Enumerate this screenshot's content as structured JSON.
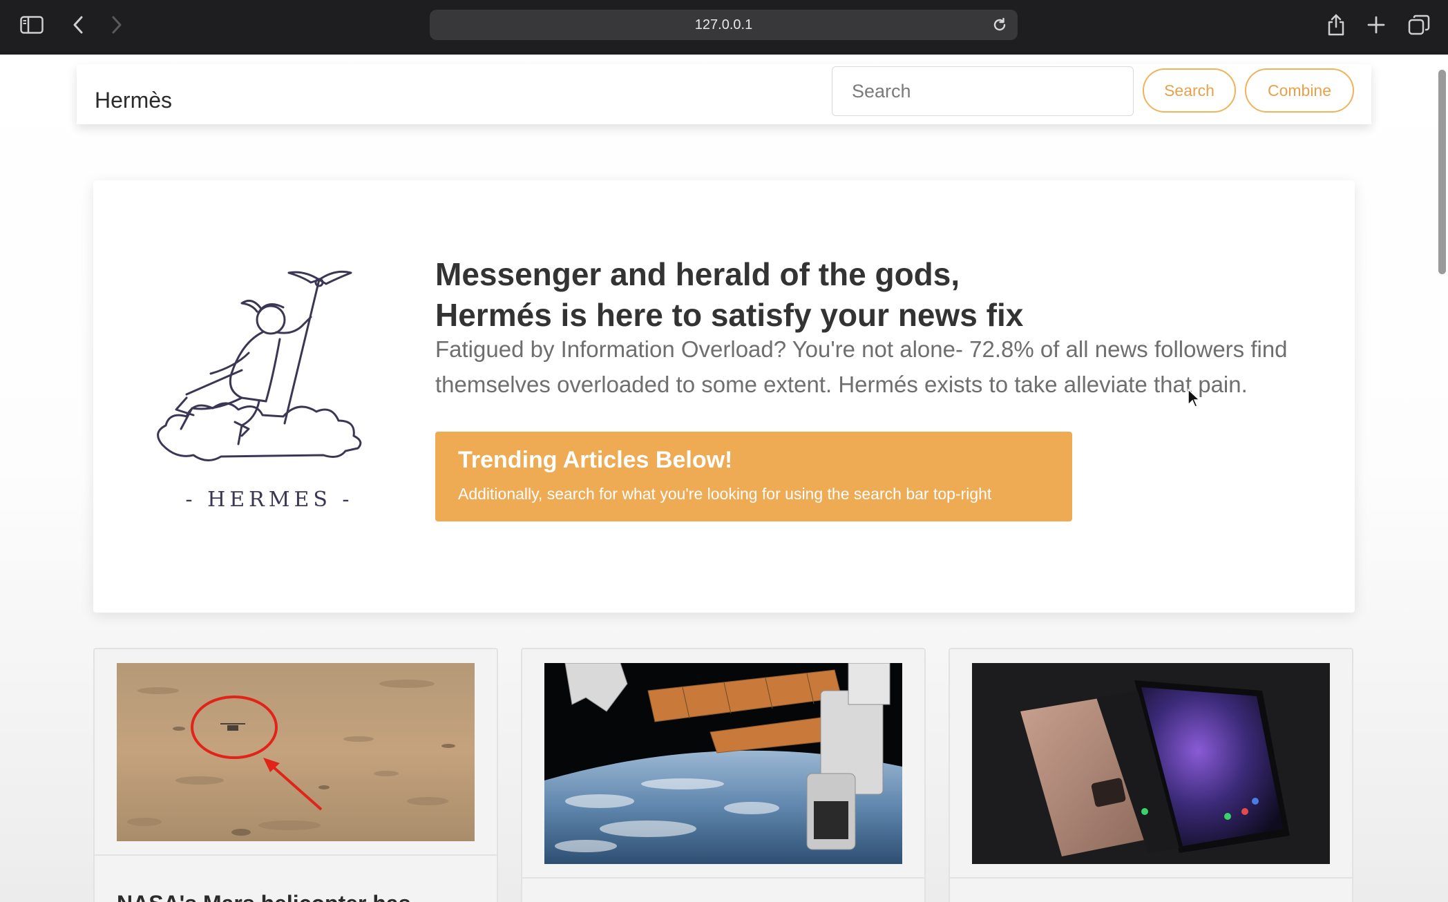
{
  "browser": {
    "url": "127.0.0.1",
    "icons": [
      "sidebar-icon",
      "back-arrow-icon",
      "forward-arrow-icon",
      "reload-icon",
      "share-icon",
      "new-tab-plus-icon",
      "tab-overview-icon"
    ]
  },
  "nav": {
    "brand": "Hermès",
    "search_placeholder": "Search",
    "search_button": "Search",
    "combine_button": "Combine",
    "accent_color": "#efab54"
  },
  "hero": {
    "logo_text": "- HERMES -",
    "title_line1": "Messenger and herald of the gods,",
    "title_line2": "Hermés is here to satisfy your news fix",
    "lead": "Fatigued by Information Overload? You're not alone- 72.8% of all news followers find themselves overloaded to some extent. Hermés exists to take alleviate that pain.",
    "callout_title": "Trending Articles Below!",
    "callout_text": "Additionally, search for what you're looking for using the search bar top-right"
  },
  "articles": [
    {
      "title": "NASA's Mars helicopter has",
      "image": "mars-helicopter-photo"
    },
    {
      "title": "",
      "image": "space-station-earth-photo"
    },
    {
      "title": "",
      "image": "foldable-phone-photo"
    }
  ]
}
